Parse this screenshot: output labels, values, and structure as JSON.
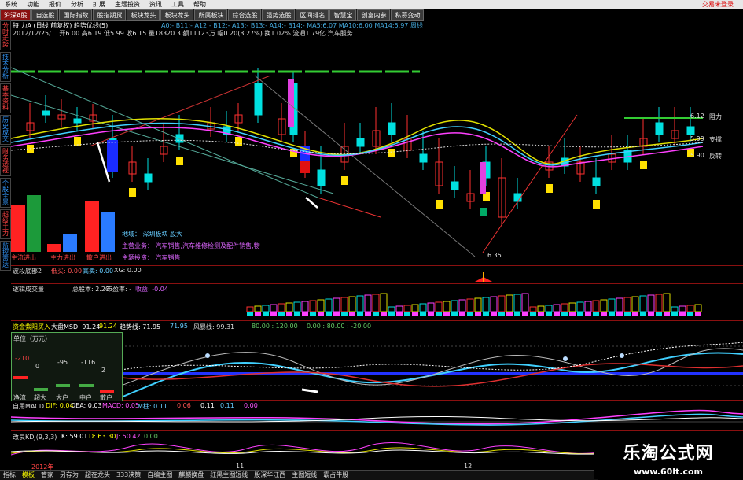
{
  "menu": [
    "系统",
    "功能",
    "报价",
    "分析",
    "扩展",
    "主题投资",
    "资讯",
    "工具",
    "帮助"
  ],
  "login_label": "交易未登录",
  "tabs": [
    "沪深A股",
    "自选股",
    "国际指数",
    "股指期货",
    "板块龙头",
    "板块龙头",
    "所属板块",
    "综合选股",
    "强势选股",
    "区间排名",
    "智慧宝",
    "创富内参",
    "私募变动"
  ],
  "active_tab_index": 0,
  "sidebar": [
    "分时走势",
    "技术分析",
    "基本资料",
    "历史成交",
    "财务透视",
    "个股全景",
    "超级主力",
    "监控雷达"
  ],
  "header": {
    "stock_title": "特  力A (日线 前复权) 趋势优线(5)",
    "date_line": "2012/12/25/二 开6.00 高6.19 低5.99 收6.15 量18320.3 额11123万 幅0.20(3.27%) 换1.02% 流通1.79亿 汽车服务",
    "ma_line": "A0:-  B11:-  A12:-  B12:-  A13:-  B13:-  A14:-  B14:-  MA5:6.07  MA10:6.00  MA14:5.97  周线"
  },
  "price_labels": {
    "resistance": {
      "value": "6.12",
      "label": "阻力"
    },
    "support": {
      "value": "5.99",
      "label": "支撑"
    },
    "reversal": {
      "value": "5.90",
      "label": "反转"
    },
    "low": "6.35"
  },
  "left_bars": {
    "labels": [
      "主流进出",
      "主力进出",
      "散户进出"
    ],
    "values": [
      {
        "red": 60,
        "green": 72
      },
      {
        "red": 10,
        "green": 22
      },
      {
        "red": 65,
        "green": 50
      }
    ]
  },
  "info_box": {
    "line1": "地域：  深圳板块   股大",
    "line2": "主营业务： 汽车销售,汽车维修检测及配件销售,物",
    "line3": "主题投资： 汽车销售"
  },
  "indicator1": {
    "name": "波段底部2",
    "v1": "低买: 0.00",
    "v2": "高卖: 0.00",
    "v3": "XG: 0.00"
  },
  "indicator2": {
    "name": "逻辑成交量",
    "v1": "总股本: 2.20",
    "v2": "市盈率: -",
    "v3": "收益: -0.04"
  },
  "indicator3": {
    "name": "资金紫阳买入",
    "v1": "大盘MSD: 91.24",
    "v2": "91.24",
    "v3": "趋势线: 71.95",
    "v4": "71.95",
    "v5": "风暴线: 99.31",
    "v6": "80.00 : 120.00",
    "v7": "0.00 : 80.00 : -20.00"
  },
  "subbox": {
    "title": "单位（万元）",
    "values": [
      "-210",
      "0",
      "-95",
      "-116",
      "2"
    ],
    "labels": [
      "净流",
      "超大",
      "大户",
      "中户",
      "散户"
    ]
  },
  "indicator4": {
    "name": "自用MACD",
    "v1": "DIF: 0.04",
    "v2": "DEA: 0.03",
    "v3": "MACD: 0.05",
    "v4": "M柱: 0.11",
    "v5": "0.06",
    "v6": "0.11",
    "v7": "0.11",
    "v8": "0.00"
  },
  "indicator5": {
    "name": "改良KDJ(9,3,3)",
    "v1": "K: 59.01",
    "v2": "D: 63.30",
    "v3": "J: 50.42",
    "v4": "0.00"
  },
  "time_labels": [
    "2012年",
    "11",
    "12"
  ],
  "bottom_tabs": [
    "指标",
    "模板",
    "管家",
    "另存为",
    "超在龙头",
    "333决策",
    "自编主图",
    "麒麟换盘",
    "红黑主图短线",
    "股深华江西",
    "主图短线",
    "霸占牛股"
  ],
  "watermark": {
    "title": "乐淘公式网",
    "url": "www.60lt.com"
  },
  "colors": {
    "up": "#ff3030",
    "down": "#00e0e0",
    "ma_yellow": "#e0e000",
    "ma_magenta": "#ff40ff",
    "accent": "#8a1010"
  }
}
